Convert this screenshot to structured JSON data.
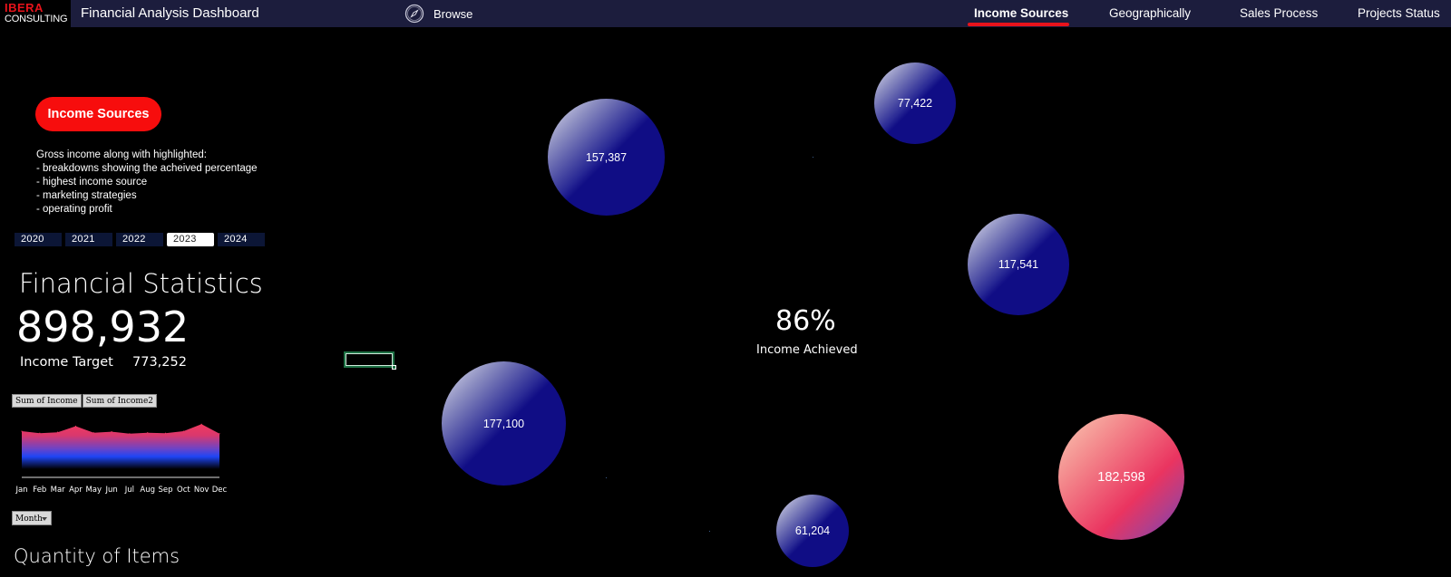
{
  "header": {
    "logo_line1": "IBERA",
    "logo_line2": "CONSULTING",
    "title": "Financial Analysis Dashboard",
    "browse_label": "Browse",
    "browse_icon": "compass-icon",
    "nav": [
      {
        "label": "Income Sources",
        "active": true
      },
      {
        "label": "Geographically",
        "active": false
      },
      {
        "label": "Sales Process",
        "active": false
      },
      {
        "label": "Projects Status",
        "active": false
      }
    ]
  },
  "section": {
    "pill_label": "Income Sources",
    "description": [
      "Gross income along with highlighted:",
      "- breakdowns showing the acheived percentage",
      "- highest income source",
      "- marketing strategies",
      "- operating profit"
    ]
  },
  "years": [
    {
      "label": "2020",
      "active": false
    },
    {
      "label": "2021",
      "active": false
    },
    {
      "label": "2022",
      "active": false
    },
    {
      "label": "2023",
      "active": true
    },
    {
      "label": "2024",
      "active": false
    }
  ],
  "stats": {
    "title": "Financial Statistics",
    "total_income": "898,932",
    "target_label": "Income Target",
    "target_value": "773,252"
  },
  "pivot": {
    "field_buttons": [
      "Sum of Income",
      "Sum of Income2"
    ],
    "month_filter": "Month"
  },
  "chart_data": {
    "type": "area",
    "title": "",
    "xlabel": "",
    "ylabel": "",
    "categories": [
      "Jan",
      "Feb",
      "Mar",
      "Apr",
      "May",
      "Jun",
      "Jul",
      "Aug",
      "Sep",
      "Oct",
      "Nov",
      "Dec"
    ],
    "series": [
      {
        "name": "Sum of Income",
        "values": [
          76,
          72,
          74,
          86,
          73,
          75,
          71,
          73,
          72,
          76,
          90,
          71
        ]
      }
    ],
    "ylim": [
      0,
      100
    ],
    "grid": false,
    "legend": "none",
    "colors": {
      "top": "#f03a5f",
      "middle": "#1e45f5",
      "bottom": "#000000"
    }
  },
  "bubbles": [
    {
      "label": "157,387",
      "value": 157387,
      "style": "blue"
    },
    {
      "label": "77,422",
      "value": 77422,
      "style": "blue"
    },
    {
      "label": "117,541",
      "value": 117541,
      "style": "blue"
    },
    {
      "label": "177,100",
      "value": 177100,
      "style": "blue"
    },
    {
      "label": "61,204",
      "value": 61204,
      "style": "blue"
    },
    {
      "label": "182,598",
      "value": 182598,
      "style": "pink"
    }
  ],
  "kpi": {
    "percent": "86%",
    "label": "Income Achieved"
  },
  "section_bottom": {
    "title": "Quantity of Items"
  },
  "colors": {
    "header_bg": "#1c1d3d",
    "accent_red": "#f70d0d",
    "bubble_blue": "#100d85"
  }
}
